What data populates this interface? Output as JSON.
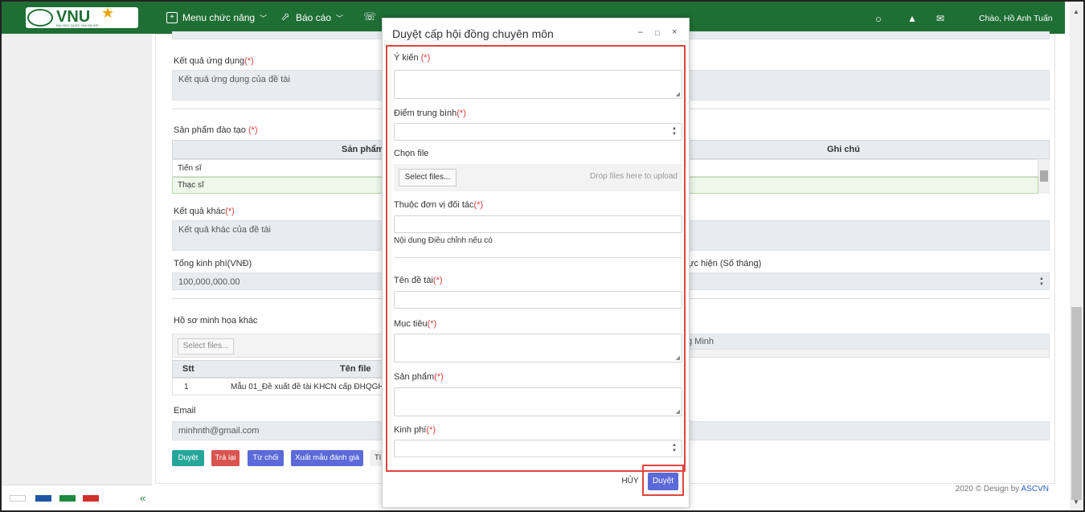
{
  "header": {
    "logo_text": "VNU",
    "logo_subtitle": "ĐẠI HỌC QUỐC GIA HÀ NỘI",
    "menu_label": "Menu chức năng",
    "report_label": "Báo cáo",
    "help_label": "Hỗ...",
    "greeting": "Chào, Hồ Anh Tuấn"
  },
  "colors": {
    "brand": "#1f6f35",
    "required": "#e03c3c",
    "highlight": "#e0443e",
    "primary": "#5b6ad8"
  },
  "form": {
    "ket_qua_ung_dung_label": "Kết quả ứng dụng",
    "ket_qua_ung_dung_value": "Kết quả ứng dụng của đề tài",
    "san_pham_dao_tao_label": "Sản phẩm đào tạo ",
    "san_pham_col": "Sản phẩm c",
    "ghi_chu_col": "Ghi chú",
    "rows": [
      "Tiến sĩ",
      "Thạc sĩ"
    ],
    "ket_qua_khac_label": "Kết quả khác",
    "ket_qua_khac_value": "Kết quả khác của đề tài",
    "tong_kinh_phi_label": "Tổng kinh phí(VNĐ)",
    "tong_kinh_phi_value": "100,000,000.00",
    "thoi_gian_label": "hực hiện (Số tháng)",
    "ho_so_label": "Hồ sơ minh họa khác",
    "select_files": "Select files...",
    "stt_col": "Stt",
    "ten_file_col": "Tên file",
    "file_row_stt": "1",
    "file_row_name": "Mẫu 01_Đề xuất đề tài KHCN cấp ĐHQGHN",
    "minh_value": "g Minh",
    "email_label": "Email",
    "email_value": "minhnth@gmail.com",
    "required_mark": "(*)"
  },
  "actions": {
    "duyet": "Duyệt",
    "tra_lai": "Trả lại",
    "tu_choi": "Từ chối",
    "xuat_mau": "Xuất mẫu đánh giá",
    "more": "Tl"
  },
  "footer": {
    "copyright": "2020 © Design by ",
    "brand": "ASCVN"
  },
  "modal": {
    "title": "Duyệt cấp hội đồng chuyên môn",
    "y_kien_label": "Ý kiến ",
    "diem_tb_label": "Điểm trung bình",
    "chon_file_label": "Chọn file",
    "select_files": "Select files...",
    "drop_hint": "Drop files here to upload",
    "don_vi_label": "Thuộc đơn vị đối tác",
    "noi_dung_label": "Nội dung Điều chỉnh nếu có",
    "ten_de_tai_label": "Tên đề tài",
    "muc_tieu_label": "Mục tiêu",
    "san_pham_label": "Sản phẩm",
    "kinh_phi_label": "Kinh phí",
    "required_mark": "(*)",
    "cancel_label": "HỦY",
    "approve_label": "Duyệt"
  }
}
